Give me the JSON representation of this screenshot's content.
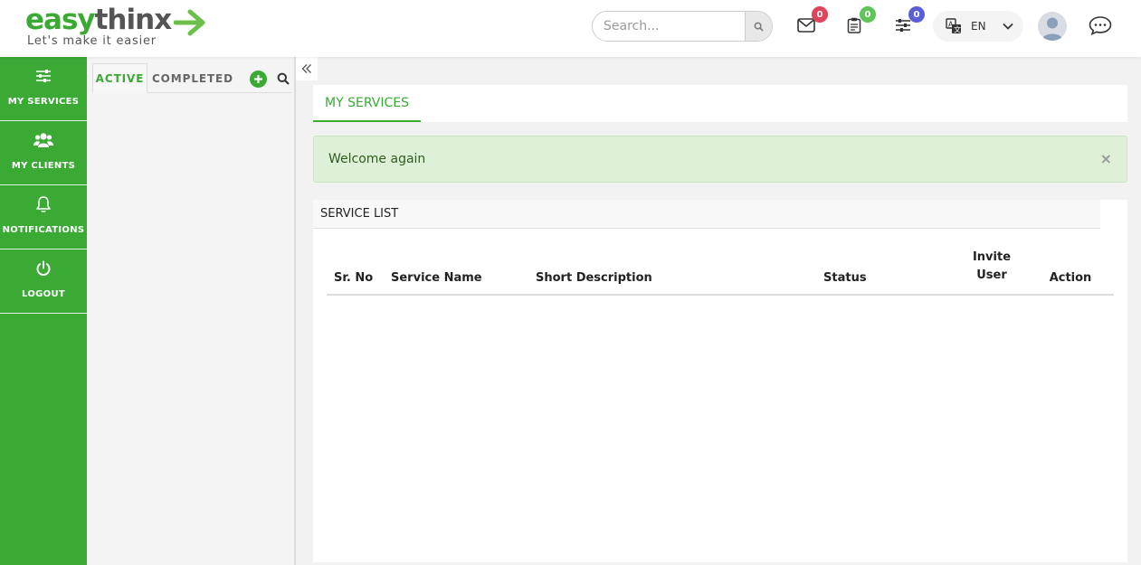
{
  "header": {
    "logo": {
      "brand_part1": "easy",
      "brand_part2": "thinx",
      "tagline": "Let's make it easier"
    },
    "search": {
      "placeholder": "Search..."
    },
    "messages": {
      "icon": "envelope-icon",
      "count": "0",
      "badge_color": "#e0445a"
    },
    "tasks": {
      "icon": "clipboard-icon",
      "count": "0",
      "badge_color": "#5fc45a"
    },
    "settings": {
      "icon": "sliders-icon",
      "count": "0",
      "badge_color": "#5a5fd6"
    },
    "language": {
      "label": "EN"
    },
    "chat": {
      "icon": "chat-bubble-icon"
    }
  },
  "sidebar": {
    "items": [
      {
        "label": "MY SERVICES",
        "icon": "sliders-icon"
      },
      {
        "label": "MY CLIENTS",
        "icon": "users-icon"
      },
      {
        "label": "NOTIFICATIONS",
        "icon": "bell-icon"
      },
      {
        "label": "LOGOUT",
        "icon": "power-icon"
      }
    ]
  },
  "panel": {
    "tabs": [
      {
        "label": "ACTIVE",
        "active": true
      },
      {
        "label": "COMPLETED",
        "active": false
      }
    ]
  },
  "main": {
    "tab": "MY SERVICES",
    "alert": {
      "message": "Welcome again",
      "close": "×"
    },
    "service_list": {
      "title": "SERVICE LIST",
      "columns": [
        "Sr. No",
        "Service Name",
        "Short Description",
        "Status",
        "Invite User",
        "Action"
      ],
      "rows": []
    }
  },
  "colors": {
    "brand_green": "#3aaa35",
    "alert_bg": "#dff0d8"
  }
}
